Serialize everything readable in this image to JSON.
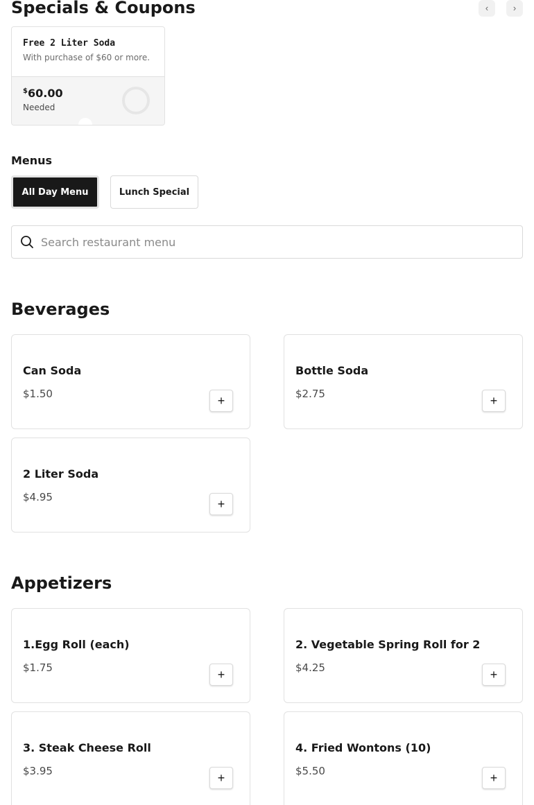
{
  "specials": {
    "title": "Specials & Coupons",
    "prev_icon": "‹",
    "next_icon": "›",
    "coupon": {
      "title": "Free 2 Liter Soda",
      "description": "With purchase of $60 or more.",
      "currency": "$",
      "amount": "60.00",
      "needed_label": "Needed",
      "progress": 0
    }
  },
  "menus": {
    "label": "Menus",
    "tabs": [
      {
        "label": "All Day Menu",
        "active": true
      },
      {
        "label": "Lunch Special",
        "active": false
      }
    ]
  },
  "search": {
    "placeholder": "Search restaurant menu",
    "value": ""
  },
  "sections": [
    {
      "title": "Beverages",
      "items": [
        {
          "name": "Can Soda",
          "price": "$1.50"
        },
        {
          "name": "Bottle Soda",
          "price": "$2.75"
        },
        {
          "name": "2 Liter Soda",
          "price": "$4.95"
        }
      ]
    },
    {
      "title": "Appetizers",
      "items": [
        {
          "name": "1.Egg Roll (each)",
          "price": "$1.75"
        },
        {
          "name": "2. Vegetable Spring Roll for 2",
          "price": "$4.25"
        },
        {
          "name": "3. Steak Cheese Roll",
          "price": "$3.95"
        },
        {
          "name": "4. Fried Wontons (10)",
          "price": "$5.50"
        }
      ]
    }
  ],
  "add_button_label": "+",
  "colors": {
    "text": "#191919",
    "active_tab_bg": "#191919",
    "border": "#e1e1e1"
  }
}
